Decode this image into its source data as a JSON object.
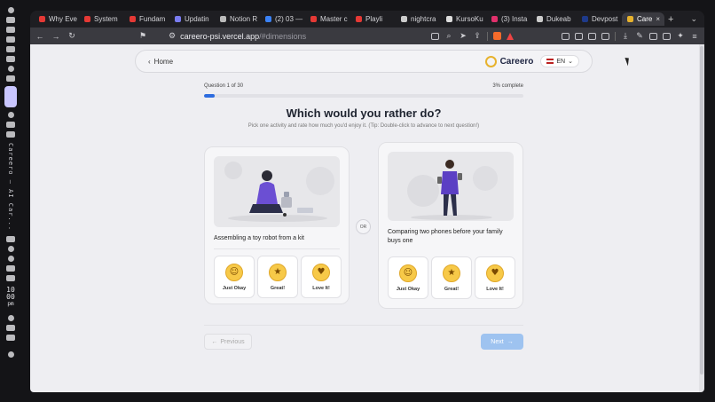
{
  "os": {
    "vertical_title": "Careero — AI Car...",
    "time_h": "10",
    "time_m": "00",
    "time_ampm": "pm"
  },
  "tabs": [
    {
      "label": "Why Eve",
      "color": "#e53935"
    },
    {
      "label": "System",
      "color": "#e53935"
    },
    {
      "label": "Fundam",
      "color": "#e53935"
    },
    {
      "label": "Updatin",
      "color": "#7a7cf0"
    },
    {
      "label": "Notion R",
      "color": "#bbbbbb"
    },
    {
      "label": "(2) 03 —",
      "color": "#3b82f6"
    },
    {
      "label": "Master c",
      "color": "#e53935"
    },
    {
      "label": "Playli",
      "color": "#e53935"
    },
    {
      "label": "nightcra",
      "color": "#cccccc"
    },
    {
      "label": "KursoKu",
      "color": "#dddddd"
    },
    {
      "label": "(3) Insta",
      "color": "#e1306c"
    },
    {
      "label": "Dukeab",
      "color": "#cccccc"
    },
    {
      "label": "Devpost",
      "color": "#1e3a8a"
    },
    {
      "label": "Care",
      "color": "#e7b22d",
      "active": true
    }
  ],
  "url": {
    "host": "careero-psi.vercel.app",
    "path": "/#dimensions"
  },
  "nav": {
    "home_label": "Home",
    "brand": "Careero",
    "lang": "EN"
  },
  "quiz": {
    "question_counter": "Question 1 of 30",
    "percent_complete": "3% complete",
    "progress": 0.033,
    "heading": "Which would you rather do?",
    "subtitle": "Pick one activity and rate how much you'd enjoy it. (Tip: Double-click to advance to next question!)",
    "or_label": "OR",
    "cards": [
      {
        "label": "Assembling a toy robot from a kit",
        "options": [
          "Just Okay",
          "Great!",
          "Love It!"
        ]
      },
      {
        "label": "Comparing two phones before your family buys one",
        "options": [
          "Just Okay",
          "Great!",
          "Love It!"
        ]
      }
    ],
    "prev_label": "Previous",
    "next_label": "Next"
  },
  "colors": {
    "accent": "#2d6cdf",
    "next_button": "#9ec3f0",
    "brand_ring": "#e7b22d"
  }
}
